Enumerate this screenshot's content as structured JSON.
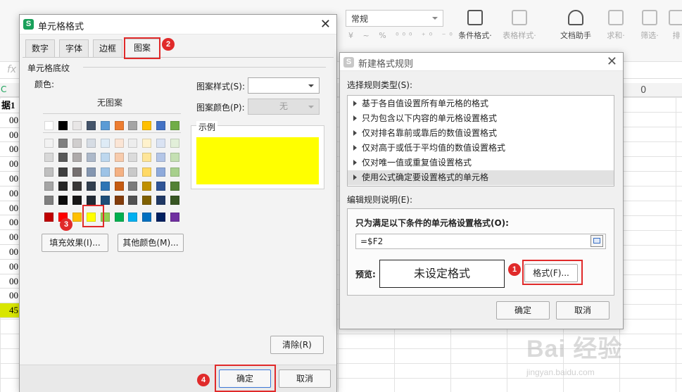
{
  "ribbon": {
    "number_format": "常规",
    "number_icons": "¥ ~ % ⁰⁰⁰ ⁺⁰ ⁻⁰",
    "tools": [
      {
        "label": "条件格式·",
        "icon": "conditional-format-icon"
      },
      {
        "label": "表格样式·",
        "icon": "table-style-icon"
      },
      {
        "label": "文档助手",
        "icon": "doc-assistant-icon"
      },
      {
        "label": "求和·",
        "icon": "sum-icon"
      },
      {
        "label": "筛选·",
        "icon": "filter-icon"
      },
      {
        "label": "排",
        "icon": "sort-icon"
      }
    ]
  },
  "sheet": {
    "fx": "fx",
    "col_header_c": "C",
    "col_header_o": "0",
    "left_cells": [
      "据1",
      "00",
      "00",
      "00",
      "00",
      "00",
      "00",
      "00",
      "00",
      "00",
      "00",
      "00",
      "00",
      "00",
      "45"
    ]
  },
  "format_dialog": {
    "title": "单元格格式",
    "tabs": [
      "数字",
      "字体",
      "边框",
      "图案"
    ],
    "section": "单元格底纹",
    "color_label": "颜色:",
    "no_pattern": "无图案",
    "pattern_style_label": "图案样式(S):",
    "pattern_color_label": "图案颜色(P):",
    "pattern_color_value": "无",
    "sample_label": "示例",
    "sample_color": "#ffff00",
    "fill_effects_button": "填充效果(I)...",
    "more_colors_button": "其他颜色(M)...",
    "clear_button": "清除(R)",
    "ok_button": "确定",
    "cancel_button": "取消",
    "palette_top": [
      "#ffffff",
      "#000000",
      "#e8e6e6",
      "#44546a",
      "#5b9bd5",
      "#ed7d31",
      "#a5a5a5",
      "#ffc000",
      "#4472c4",
      "#70ad47"
    ],
    "palette_tints": [
      [
        "#f2f2f2",
        "#7f7f7f",
        "#d0cece",
        "#d6dce4",
        "#deebf6",
        "#fbe5d5",
        "#ededed",
        "#fff2cc",
        "#dae3f3",
        "#e2efd9"
      ],
      [
        "#d8d8d8",
        "#595959",
        "#aeaaaa",
        "#adb9ca",
        "#bdd7ee",
        "#f7cbac",
        "#dbdbdb",
        "#fee599",
        "#b4c6e7",
        "#c5e0b3"
      ],
      [
        "#bfbfbf",
        "#3f3f3f",
        "#757070",
        "#8496b0",
        "#9dc3e6",
        "#f4b183",
        "#c9c9c9",
        "#ffd965",
        "#8eaadb",
        "#a8d08d"
      ],
      [
        "#a5a5a5",
        "#262626",
        "#3a3838",
        "#323f4f",
        "#2e75b5",
        "#c55a11",
        "#7b7b7b",
        "#bf9000",
        "#2f5496",
        "#538135"
      ],
      [
        "#7f7f7f",
        "#0c0c0c",
        "#171616",
        "#222a35",
        "#1e4e79",
        "#833c0b",
        "#525252",
        "#7f6000",
        "#1f3864",
        "#375623"
      ]
    ],
    "palette_standard": [
      "#c00000",
      "#ff0000",
      "#ffc000",
      "#ffff00",
      "#92d050",
      "#00b050",
      "#00b0f0",
      "#0070c0",
      "#002060",
      "#7030a0"
    ]
  },
  "rule_dialog": {
    "title": "新建格式规则",
    "select_type_label": "选择规则类型(S):",
    "rule_types": [
      "基于各自值设置所有单元格的格式",
      "只为包含以下内容的单元格设置格式",
      "仅对排名靠前或靠后的数值设置格式",
      "仅对高于或低于平均值的数值设置格式",
      "仅对唯一值或重复值设置格式",
      "使用公式确定要设置格式的单元格"
    ],
    "edit_desc_label": "编辑规则说明(E):",
    "condition_label": "只为满足以下条件的单元格设置格式(O):",
    "formula_value": "=$F2",
    "preview_label": "预览:",
    "preview_text": "未设定格式",
    "format_button": "格式(F)...",
    "ok_button": "确定",
    "cancel_button": "取消"
  },
  "badges": [
    "1",
    "2",
    "3",
    "4"
  ],
  "watermark": {
    "main": "Bai 经验",
    "sub": "jingyan.baidu.com"
  }
}
